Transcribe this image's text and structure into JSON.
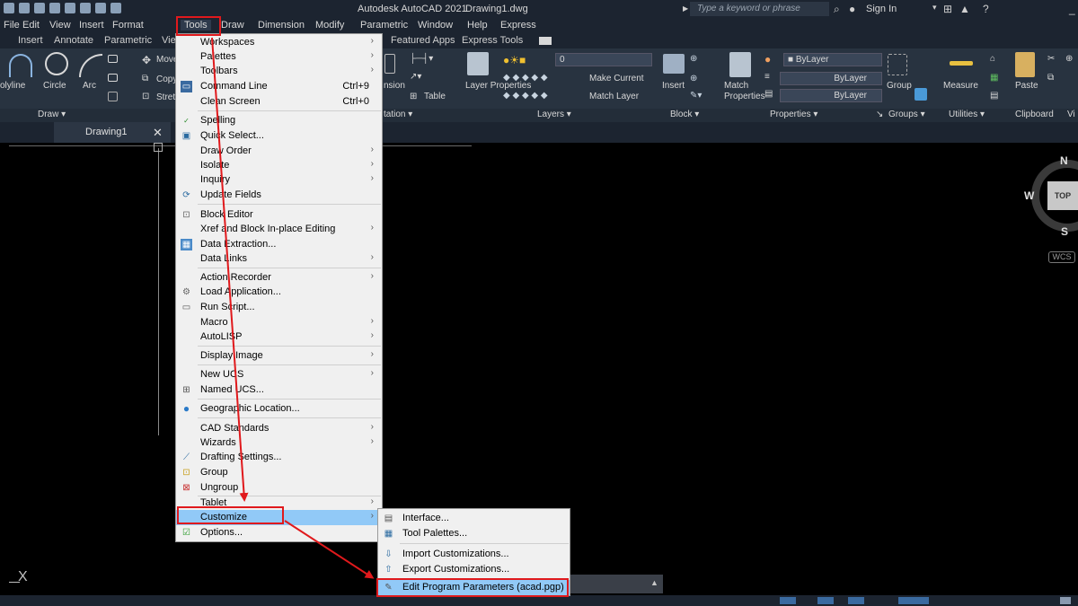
{
  "window": {
    "app_title": "Autodesk AutoCAD 2021",
    "file_title": "Drawing1.dwg",
    "search_placeholder": "Type a keyword or phrase",
    "sign_in": "Sign In"
  },
  "menubar": [
    "File",
    "Edit",
    "View",
    "Insert",
    "Format",
    "Tools",
    "Draw",
    "Dimension",
    "Modify",
    "Parametric",
    "Window",
    "Help",
    "Express"
  ],
  "ribbon_tabs": [
    "Insert",
    "Annotate",
    "Parametric",
    "Vie",
    "Featured Apps",
    "Express Tools"
  ],
  "ribbon": {
    "draw_tools": [
      "olyline",
      "Circle",
      "Arc"
    ],
    "modify_tools": [
      "Move",
      "Copy",
      "Stret"
    ],
    "dimension_tools": [
      "nsion",
      "Table"
    ],
    "layer_tools": [
      "Layer Properties",
      "Make Current",
      "Match Layer"
    ],
    "layer_value": "0",
    "insert": "Insert",
    "match_properties": "Match Properties",
    "bylayer_values": [
      "ByLayer",
      "ByLayer",
      "ByLayer"
    ],
    "group": "Group",
    "measure": "Measure",
    "paste": "Paste",
    "panels": [
      "Draw",
      "tation",
      "Layers",
      "Block",
      "Properties",
      "Groups",
      "Utilities",
      "Clipboard",
      "Vi"
    ]
  },
  "doc_tab": {
    "label": "Drawing1",
    "close": "✕"
  },
  "tools_menu": {
    "items": [
      {
        "label": "Workspaces",
        "arrow": true
      },
      {
        "label": "Palettes",
        "arrow": true
      },
      {
        "label": "Toolbars",
        "arrow": true
      },
      {
        "label": "Command Line",
        "shortcut": "Ctrl+9"
      },
      {
        "label": "Clean Screen",
        "shortcut": "Ctrl+0"
      },
      {
        "label": "Spelling"
      },
      {
        "label": "Quick Select..."
      },
      {
        "label": "Draw Order",
        "arrow": true
      },
      {
        "label": "Isolate",
        "arrow": true
      },
      {
        "label": "Inquiry",
        "arrow": true
      },
      {
        "label": "Update Fields"
      },
      {
        "label": "Block Editor"
      },
      {
        "label": "Xref and Block In-place Editing",
        "arrow": true
      },
      {
        "label": "Data Extraction..."
      },
      {
        "label": "Data Links",
        "arrow": true
      },
      {
        "label": "Action Recorder",
        "arrow": true
      },
      {
        "label": "Load Application..."
      },
      {
        "label": "Run Script..."
      },
      {
        "label": "Macro",
        "arrow": true
      },
      {
        "label": "AutoLISP",
        "arrow": true
      },
      {
        "label": "Display Image",
        "arrow": true
      },
      {
        "label": "New UCS",
        "arrow": true
      },
      {
        "label": "Named UCS..."
      },
      {
        "label": "Geographic Location..."
      },
      {
        "label": "CAD Standards",
        "arrow": true
      },
      {
        "label": "Wizards",
        "arrow": true
      },
      {
        "label": "Drafting Settings..."
      },
      {
        "label": "Group"
      },
      {
        "label": "Ungroup"
      },
      {
        "label": "Tablet",
        "arrow": true
      },
      {
        "label": "Customize",
        "arrow": true
      },
      {
        "label": "Options..."
      }
    ],
    "arrow_glyph": "›"
  },
  "customize_submenu": {
    "items": [
      {
        "label": "Interface..."
      },
      {
        "label": "Tool Palettes..."
      },
      {
        "label": "Import Customizations..."
      },
      {
        "label": "Export Customizations..."
      },
      {
        "label": "Edit Program Parameters (acad.pgp)"
      }
    ]
  },
  "viewcube": {
    "north": "N",
    "west": "W",
    "south": "S",
    "top": "TOP",
    "wcs": "WCS"
  },
  "ucs_label": "X",
  "colors": {
    "annotation": "#e0191c",
    "highlight": "#91c9f7"
  }
}
